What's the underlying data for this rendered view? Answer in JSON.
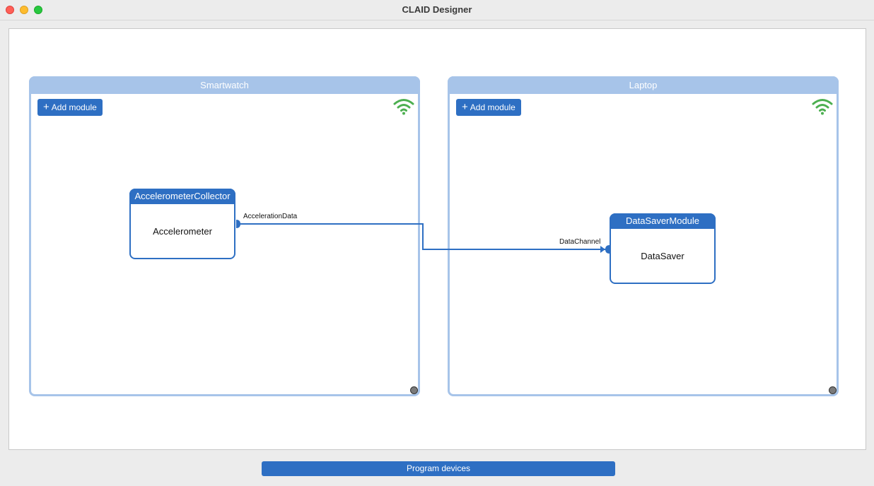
{
  "window": {
    "title": "CLAID Designer"
  },
  "devices": [
    {
      "name": "Smartwatch",
      "add_module_label": "Add module",
      "modules": [
        {
          "title": "AccelerometerCollector",
          "body": "Accelerometer",
          "output_channel": "AccelerationData"
        }
      ]
    },
    {
      "name": "Laptop",
      "add_module_label": "Add module",
      "modules": [
        {
          "title": "DataSaverModule",
          "body": "DataSaver",
          "input_channel": "DataChannel"
        }
      ]
    }
  ],
  "footer": {
    "program_label": "Program devices"
  },
  "colors": {
    "accent": "#2e6fc3",
    "device_border": "#a7c4e9",
    "wifi": "#4caf50"
  },
  "icons": {
    "add": "plus-icon",
    "connection_status": "wifi-icon",
    "resize": "resize-handle-icon"
  }
}
